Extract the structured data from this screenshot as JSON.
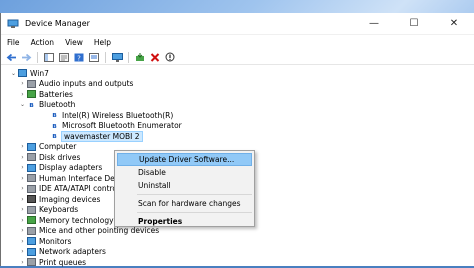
{
  "window": {
    "title": "Device Manager",
    "controls": {
      "minimize": "—",
      "maximize": "☐",
      "close": "✕"
    }
  },
  "menu": [
    "File",
    "Action",
    "View",
    "Help"
  ],
  "tree": {
    "root": "Win7",
    "items": [
      {
        "label": "Audio inputs and outputs",
        "level": 1,
        "expanded": false
      },
      {
        "label": "Batteries",
        "level": 1,
        "expanded": false
      },
      {
        "label": "Bluetooth",
        "level": 1,
        "expanded": true
      },
      {
        "label": "Intel(R) Wireless Bluetooth(R)",
        "level": 2
      },
      {
        "label": "Microsoft Bluetooth Enumerator",
        "level": 2
      },
      {
        "label": "wavemaster MOBI 2",
        "level": 2,
        "selected": true
      },
      {
        "label": "Computer",
        "level": 1,
        "expanded": false
      },
      {
        "label": "Disk drives",
        "level": 1,
        "expanded": false
      },
      {
        "label": "Display adapters",
        "level": 1,
        "expanded": false
      },
      {
        "label": "Human Interface Dev...",
        "level": 1,
        "expanded": false
      },
      {
        "label": "IDE ATA/ATAPI controllers",
        "level": 1,
        "expanded": false
      },
      {
        "label": "Imaging devices",
        "level": 1,
        "expanded": false
      },
      {
        "label": "Keyboards",
        "level": 1,
        "expanded": false
      },
      {
        "label": "Memory technology devices",
        "level": 1,
        "expanded": false
      },
      {
        "label": "Mice and other pointing devices",
        "level": 1,
        "expanded": false
      },
      {
        "label": "Monitors",
        "level": 1,
        "expanded": false
      },
      {
        "label": "Network adapters",
        "level": 1,
        "expanded": false
      },
      {
        "label": "Print queues",
        "level": 1,
        "expanded": false
      }
    ]
  },
  "context_menu": {
    "update": "Update Driver Software...",
    "disable": "Disable",
    "uninstall": "Uninstall",
    "scan": "Scan for hardware changes",
    "properties": "Properties"
  },
  "colors": {
    "selection": "#cce8ff",
    "menu_hover": "#91c9f7"
  }
}
